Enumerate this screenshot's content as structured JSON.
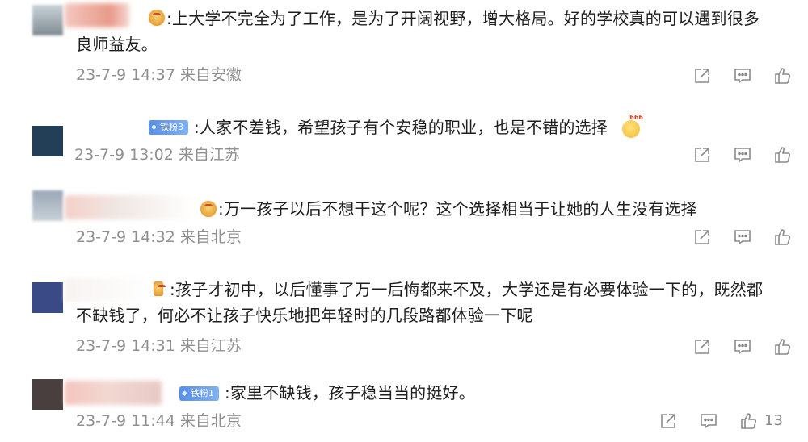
{
  "comments": [
    {
      "text_line1": ":上大学不完全为了工作，是为了开阔视野，增大格局。好的学校真的可以遇到很多",
      "text_line2": "良师益友。",
      "time": "23-7-9 14:37",
      "location": "来自安徽",
      "avatar_color": "#8a9aa6",
      "badge": "crown"
    },
    {
      "text_line1": ":人家不差钱，希望孩子有个安稳的职业，也是不错的选择",
      "time": "23-7-9 13:02",
      "location": "来自江苏",
      "avatar_color": "#233f57",
      "badge": "fan",
      "fan_label": "铁粉3"
    },
    {
      "text_line1": ":万一孩子以后不想干这个呢？这个选择相当于让她的人生没有选择",
      "time": "23-7-9 14:32",
      "location": "来自北京",
      "avatar_color": "#aab3c2",
      "badge": "crown"
    },
    {
      "text_line1": ":孩子才初中，以后懂事了万一后悔都来不及，大学还是有必要体验一下的，既然都",
      "text_line2": "不缺钱了，何必不让孩子快乐地把年轻时的几段路都体验一下呢",
      "time": "23-7-9 14:31",
      "location": "来自江苏",
      "avatar_color": "#3a4a86",
      "badge": "small"
    },
    {
      "text_line1": ":家里不缺钱，孩子稳当当的挺好。",
      "time": "23-7-9 11:44",
      "location": "来自北京",
      "avatar_color": "#4a3f3f",
      "badge": "fan",
      "fan_label": "铁粉1",
      "like_count": "13"
    }
  ],
  "icons": {
    "share": "share-icon",
    "comment": "comment-icon",
    "like": "thumbs-up-icon"
  }
}
